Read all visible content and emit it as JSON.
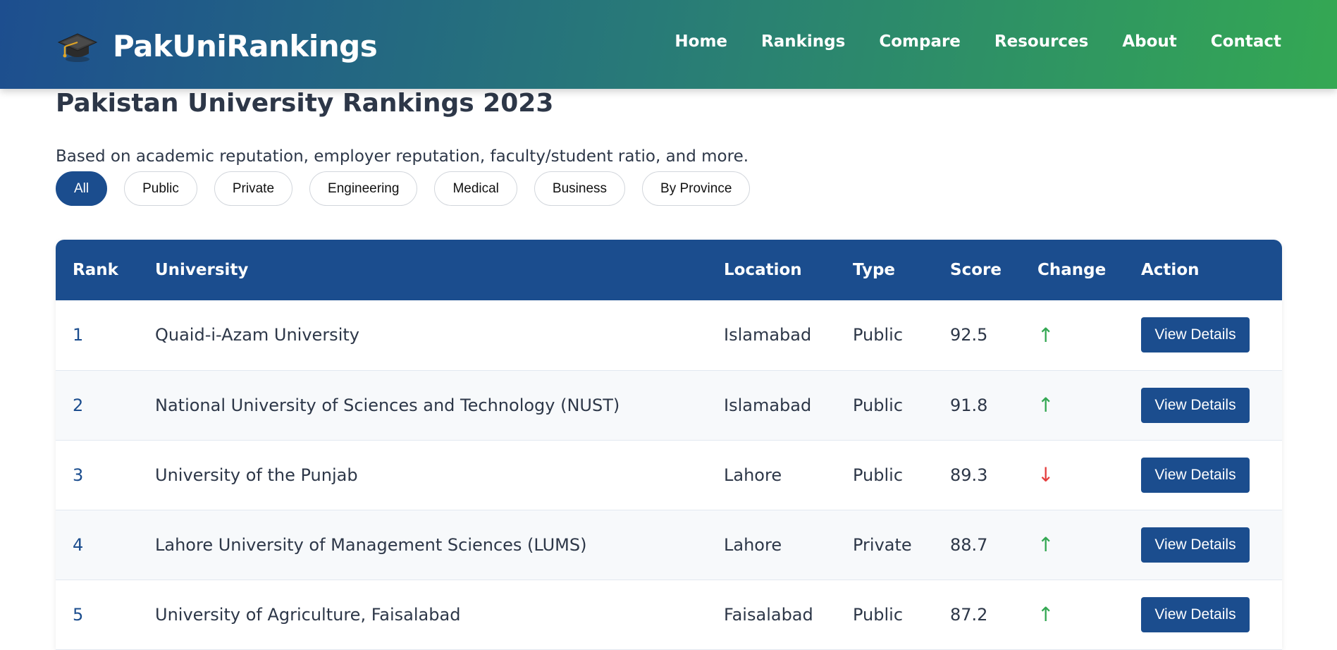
{
  "header": {
    "brand": "PakUniRankings",
    "brand_icon": "graduation-cap-icon",
    "nav": [
      "Home",
      "Rankings",
      "Compare",
      "Resources",
      "About",
      "Contact"
    ]
  },
  "main": {
    "title": "Pakistan University Rankings 2023",
    "subtitle": "Based on academic reputation, employer reputation, faculty/student ratio, and more.",
    "filters": [
      "All",
      "Public",
      "Private",
      "Engineering",
      "Medical",
      "Business",
      "By Province"
    ],
    "active_filter": "All"
  },
  "table": {
    "columns": [
      "Rank",
      "University",
      "Location",
      "Type",
      "Score",
      "Change",
      "Action"
    ],
    "rows": [
      {
        "rank": "1",
        "university": "Quaid-i-Azam University",
        "location": "Islamabad",
        "type": "Public",
        "score": "92.5",
        "change": "↑",
        "direction": "up",
        "action": "View Details"
      },
      {
        "rank": "2",
        "university": "National University of Sciences and Technology (NUST)",
        "location": "Islamabad",
        "type": "Public",
        "score": "91.8",
        "change": "↑",
        "direction": "up",
        "action": "View Details"
      },
      {
        "rank": "3",
        "university": "University of the Punjab",
        "location": "Lahore",
        "type": "Public",
        "score": "89.3",
        "change": "↓",
        "direction": "down",
        "action": "View Details"
      },
      {
        "rank": "4",
        "university": "Lahore University of Management Sciences (LUMS)",
        "location": "Lahore",
        "type": "Private",
        "score": "88.7",
        "change": "↑",
        "direction": "up",
        "action": "View Details"
      },
      {
        "rank": "5",
        "university": "University of Agriculture, Faisalabad",
        "location": "Faisalabad",
        "type": "Public",
        "score": "87.2",
        "change": "↑",
        "direction": "up",
        "action": "View Details"
      }
    ]
  },
  "colors": {
    "primary": "#1b4d8e",
    "accent_green": "#34a853",
    "up": "#34a853",
    "down": "#e53e3e"
  }
}
